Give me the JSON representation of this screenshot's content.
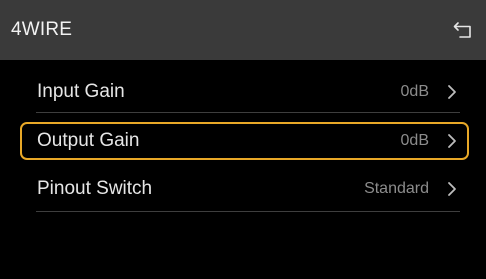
{
  "header": {
    "title": "4WIRE",
    "back_icon": "return-arrow-icon"
  },
  "menu": {
    "items": [
      {
        "label": "Input Gain",
        "value": "0dB",
        "selected": false
      },
      {
        "label": "Output Gain",
        "value": "0dB",
        "selected": true
      },
      {
        "label": "Pinout Switch",
        "value": "Standard",
        "selected": false
      }
    ]
  },
  "colors": {
    "header_bg": "#3a3a3a",
    "background": "#000000",
    "selection_border": "#e8a827",
    "value_text": "#8c8c8c"
  }
}
